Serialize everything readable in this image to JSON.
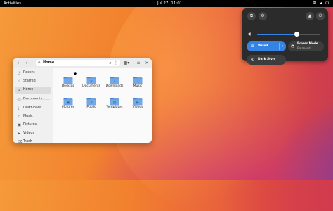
{
  "topbar": {
    "activities": "Activities",
    "date": "Jul 27",
    "time": "11:01",
    "icons": [
      "network-icon",
      "volume-icon",
      "power-icon"
    ]
  },
  "quick_settings": {
    "buttons": [
      "screenshot-icon",
      "settings-icon",
      "lock-icon",
      "power-icon"
    ],
    "volume_level": 0.62,
    "wired_label": "Wired",
    "power_mode_label": "Power Mode",
    "power_mode_value": "Balanced",
    "dark_style_label": "Dark Style"
  },
  "files": {
    "location": "Home",
    "sidebar": [
      {
        "label": "Recent",
        "icon": "clock-icon"
      },
      {
        "label": "Starred",
        "icon": "star-icon"
      },
      {
        "label": "Home",
        "icon": "home-icon"
      },
      {
        "label": "Documents",
        "icon": "document-icon"
      },
      {
        "label": "Downloads",
        "icon": "download-icon"
      },
      {
        "label": "Music",
        "icon": "music-icon"
      },
      {
        "label": "Pictures",
        "icon": "picture-icon"
      },
      {
        "label": "Videos",
        "icon": "video-icon"
      },
      {
        "label": "Trash",
        "icon": "trash-icon"
      }
    ],
    "folders": [
      {
        "label": "Desktop",
        "icon": "folder-icon"
      },
      {
        "label": "Documents",
        "icon": "folder-document-icon"
      },
      {
        "label": "Downloads",
        "icon": "folder-download-icon"
      },
      {
        "label": "Music",
        "icon": "folder-music-icon"
      },
      {
        "label": "Pictures",
        "icon": "folder-picture-icon"
      },
      {
        "label": "Public",
        "icon": "folder-share-icon"
      },
      {
        "label": "Templates",
        "icon": "folder-template-icon"
      },
      {
        "label": "Videos",
        "icon": "folder-video-icon"
      }
    ]
  },
  "colors": {
    "accent": "#3584e4",
    "folder": "#73a8e6",
    "topbar": "#000000"
  }
}
